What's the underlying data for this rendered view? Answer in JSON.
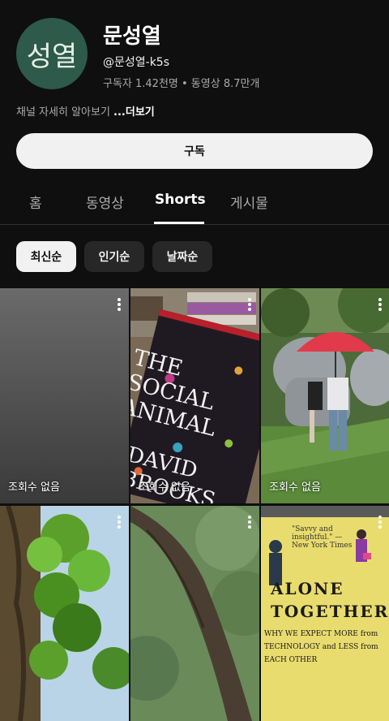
{
  "channel": {
    "avatar_text": "성열",
    "name": "문성열",
    "handle": "@문성열-k5s",
    "stats": "구독자 1.42천명 • 동영상 8.7만개",
    "description": "채널 자세히 알아보기",
    "more_label": "...더보기",
    "subscribe_label": "구독"
  },
  "tabs": [
    {
      "label": "홈"
    },
    {
      "label": "동영상"
    },
    {
      "label": "Shorts",
      "active": true
    },
    {
      "label": "게시물"
    }
  ],
  "chips": [
    {
      "label": "최신순",
      "active": true
    },
    {
      "label": "인기순"
    },
    {
      "label": "날짜순"
    }
  ],
  "shorts": [
    {
      "views": "조회수 없음",
      "thumb": "gray-blank"
    },
    {
      "views": "조회수 없음",
      "thumb": "book-social-animal"
    },
    {
      "views": "조회수 없음",
      "thumb": "park-red-umbrella"
    },
    {
      "views": "",
      "thumb": "tree-vines"
    },
    {
      "views": "",
      "thumb": "tree-trunk-hill"
    },
    {
      "views": "",
      "thumb": "book-alone-together"
    }
  ],
  "thumb_text": {
    "book1_title": "THE SOCIAL ANIMAL",
    "book1_author": "DAVID BROOKS",
    "book2_title": "ALONE TOGETHER",
    "book2_sub": "WHY WE EXPECT MORE from TECHNOLOGY and LESS from EACH OTHER",
    "book2_quote": "\"Savvy and insightful.\" —New York Times"
  },
  "colors": {
    "background": "#0f0f0f",
    "avatar": "#2d5a4a",
    "chip": "#272727",
    "accent_white": "#f1f1f1"
  }
}
